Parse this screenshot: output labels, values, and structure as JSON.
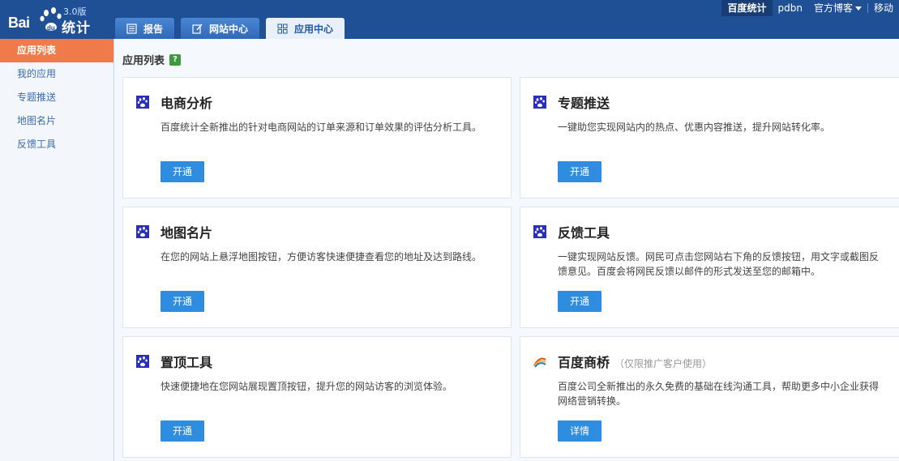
{
  "brand": {
    "logo_left": "Bai",
    "logo_right": "统计",
    "version": "3.0版"
  },
  "nav_tabs": [
    {
      "label": "报告"
    },
    {
      "label": "网站中心"
    },
    {
      "label": "应用中心"
    }
  ],
  "top_links": {
    "baidu_tongji": "百度统计",
    "user": "pdbn",
    "blog": "官方博客",
    "mobile": "移动"
  },
  "sidebar": {
    "items": [
      {
        "label": "应用列表",
        "active": true
      },
      {
        "label": "我的应用"
      },
      {
        "label": "专题推送"
      },
      {
        "label": "地图名片"
      },
      {
        "label": "反馈工具"
      }
    ]
  },
  "main": {
    "heading": "应用列表",
    "help": "?",
    "cards": [
      {
        "title": "电商分析",
        "note": "",
        "desc": "百度统计全新推出的针对电商网站的订单来源和订单效果的评估分析工具。",
        "button": "开通",
        "icon": "baidu-paw-icon"
      },
      {
        "title": "专题推送",
        "note": "",
        "desc": "一键助您实现网站内的热点、优惠内容推送，提升网站转化率。",
        "button": "开通",
        "icon": "baidu-paw-icon"
      },
      {
        "title": "地图名片",
        "note": "",
        "desc": "在您的网站上悬浮地图按钮，方便访客快速便捷查看您的地址及达到路线。",
        "button": "开通",
        "icon": "baidu-paw-icon"
      },
      {
        "title": "反馈工具",
        "note": "",
        "desc": "一键实现网站反馈。网民可点击您网站右下角的反馈按钮，用文字或截图反馈意见。百度会将网民反馈以邮件的形式发送至您的邮箱中。",
        "button": "开通",
        "icon": "baidu-paw-icon"
      },
      {
        "title": "置顶工具",
        "note": "",
        "desc": "快速便捷地在您网站展现置顶按钮，提升您的网站访客的浏览体验。",
        "button": "开通",
        "icon": "baidu-paw-icon"
      },
      {
        "title": "百度商桥",
        "note": "（仅限推广客户使用）",
        "desc": "百度公司全新推出的永久免费的基础在线沟通工具，帮助更多中小企业获得网络营销转换。",
        "button": "详情",
        "icon": "shangqiao-bridge-icon"
      }
    ]
  }
}
